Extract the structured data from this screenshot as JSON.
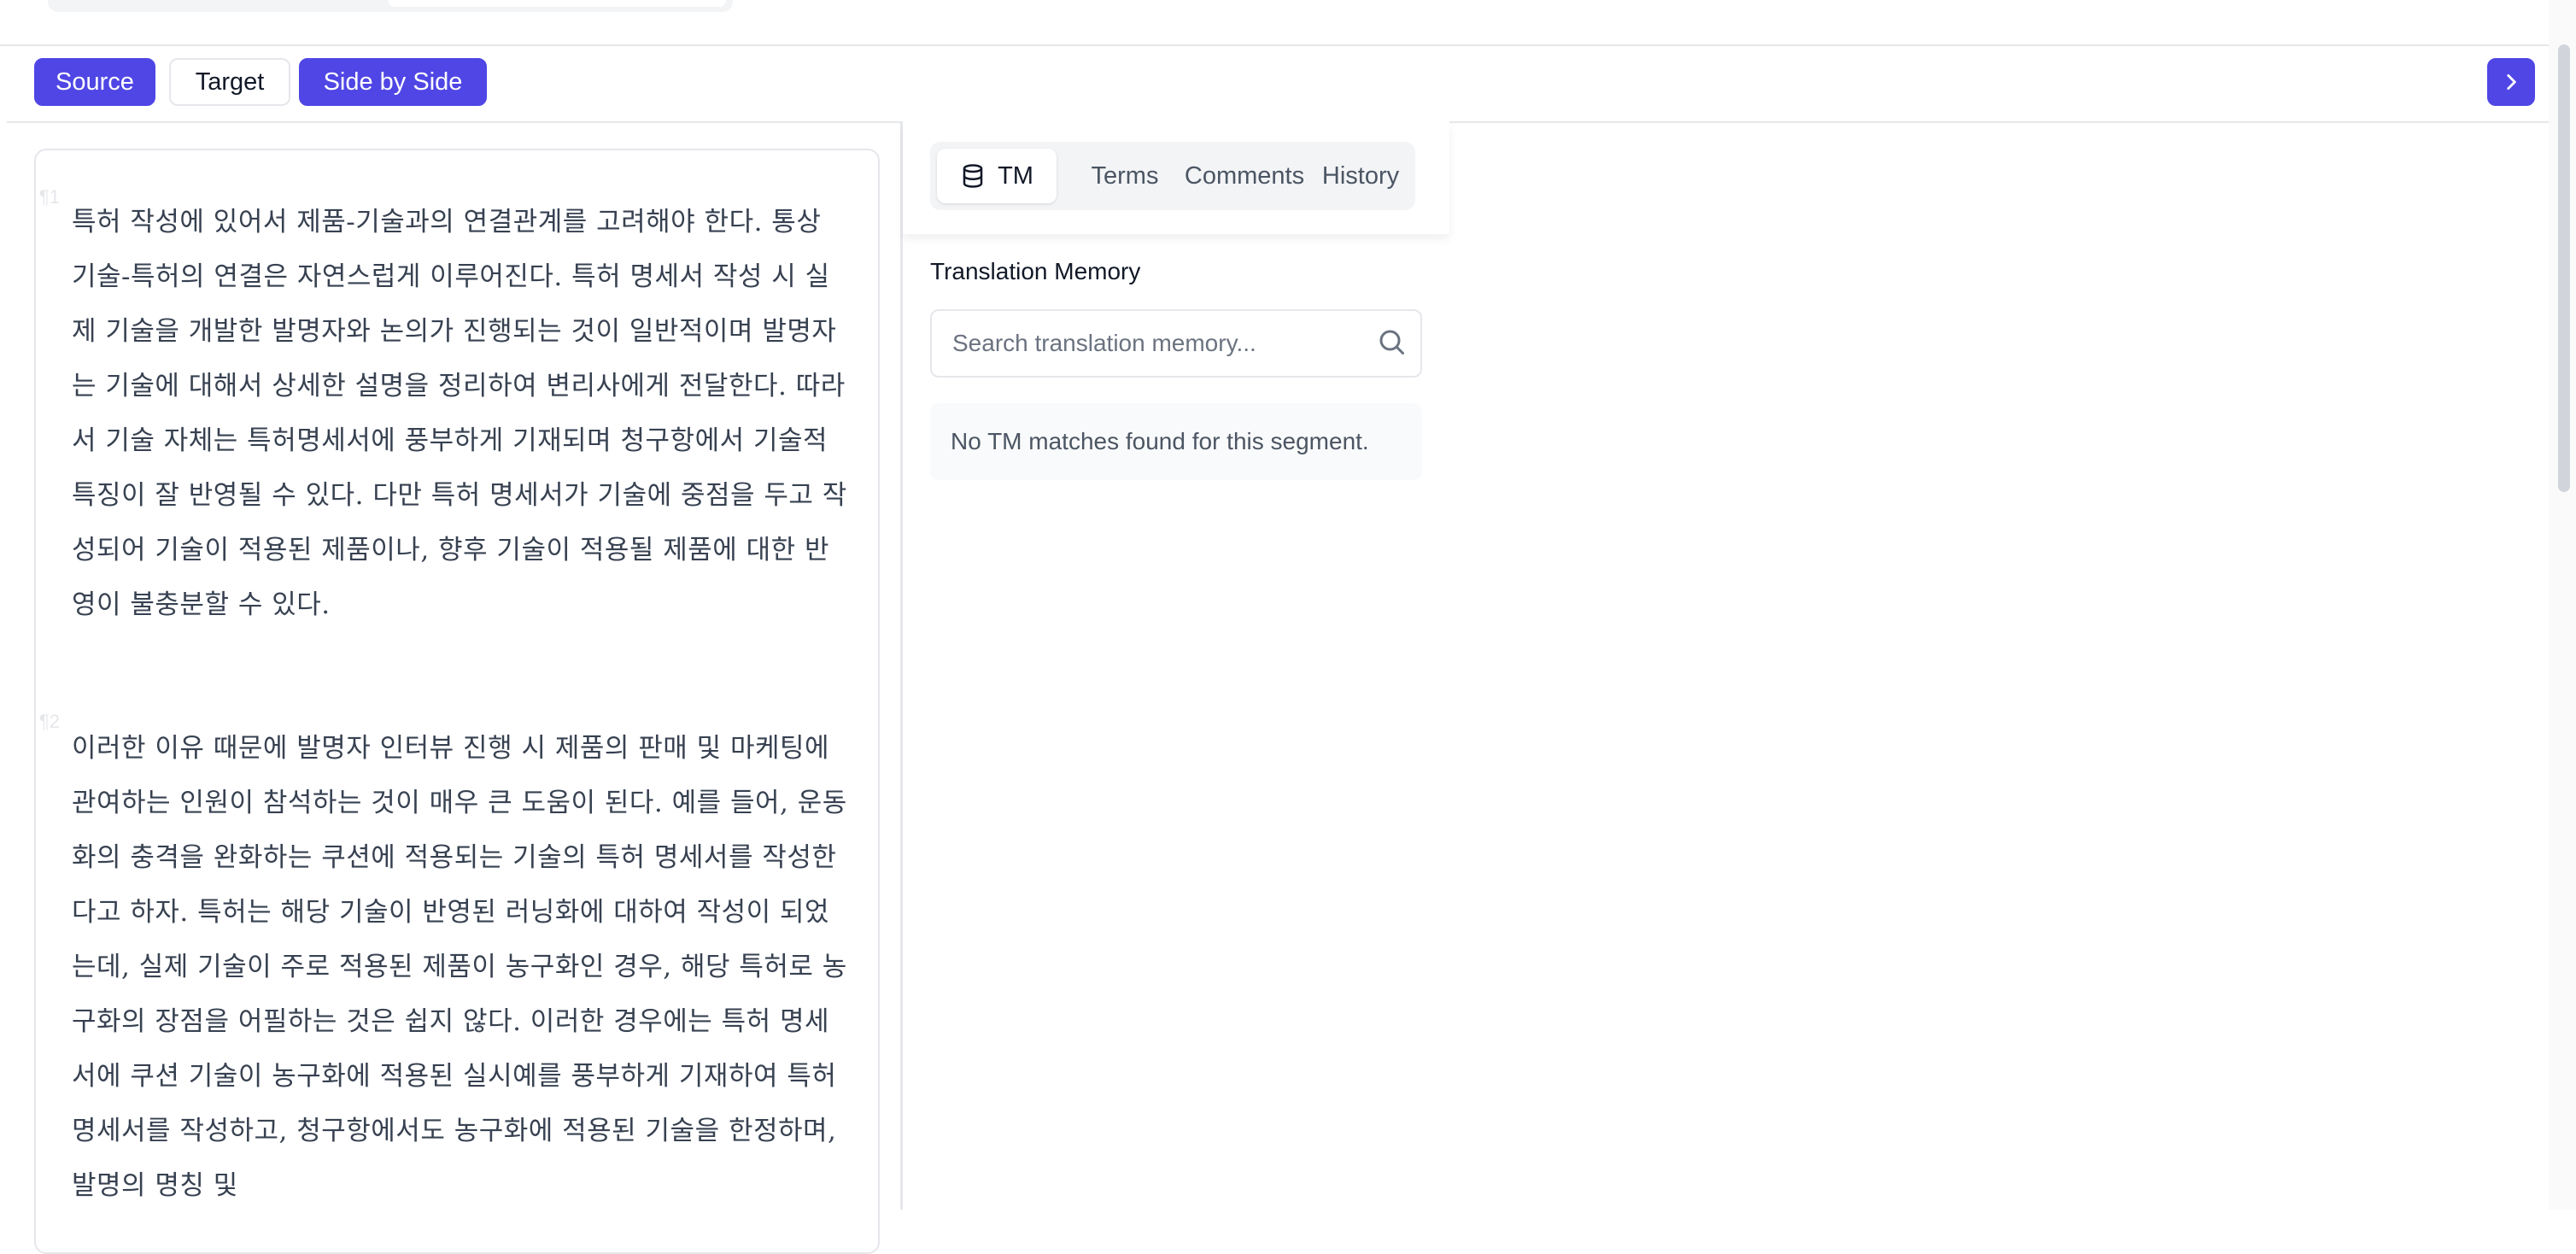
{
  "view_modes": {
    "source": "Source",
    "target": "Target",
    "side_by_side": "Side by Side",
    "active": "Side by Side"
  },
  "editor": {
    "paragraphs": [
      {
        "number": "¶1",
        "text": "특허 작성에 있어서 제품-기술과의 연결관계를 고려해야 한다. 통상 기술-특허의 연결은 자연스럽게 이루어진다. 특허 명세서 작성 시 실제 기술을 개발한 발명자와 논의가 진행되는 것이 일반적이며 발명자는 기술에 대해서 상세한 설명을 정리하여 변리사에게 전달한다. 따라서 기술 자체는 특허명세서에 풍부하게 기재되며 청구항에서 기술적 특징이 잘 반영될 수 있다. 다만 특허 명세서가 기술에 중점을 두고 작성되어 기술이 적용된 제품이나, 향후 기술이 적용될 제품에 대한 반영이 불충분할 수 있다."
      },
      {
        "number": "¶2",
        "text": "이러한 이유 때문에 발명자 인터뷰 진행 시 제품의 판매 및 마케팅에 관여하는 인원이 참석하는 것이 매우 큰 도움이 된다. 예를 들어, 운동화의 충격을 완화하는 쿠션에 적용되는 기술의 특허 명세서를 작성한다고 하자. 특허는 해당 기술이 반영된 러닝화에 대하여 작성이 되었는데, 실제 기술이 주로 적용된 제품이 농구화인 경우, 해당 특허로 농구화의 장점을 어필하는 것은 쉽지 않다. 이러한 경우에는 특허 명세서에 쿠션 기술이 농구화에 적용된 실시예를 풍부하게 기재하여 특허 명세서를 작성하고, 청구항에서도 농구화에 적용된 기술을 한정하며, 발명의 명칭 및"
      }
    ]
  },
  "side_panel": {
    "tabs": [
      {
        "label": "TM",
        "icon": "database-icon",
        "active": true
      },
      {
        "label": "Terms",
        "active": false
      },
      {
        "label": "Comments",
        "active": false
      },
      {
        "label": "History",
        "active": false
      }
    ],
    "tm": {
      "title": "Translation Memory",
      "search_placeholder": "Search translation memory...",
      "search_value": "",
      "empty_message": "No TM matches found for this segment."
    }
  },
  "colors": {
    "accent": "#4f46e5",
    "border": "#e5e7eb",
    "muted_text": "#4b5563",
    "panel_bg": "#f3f4f6"
  }
}
